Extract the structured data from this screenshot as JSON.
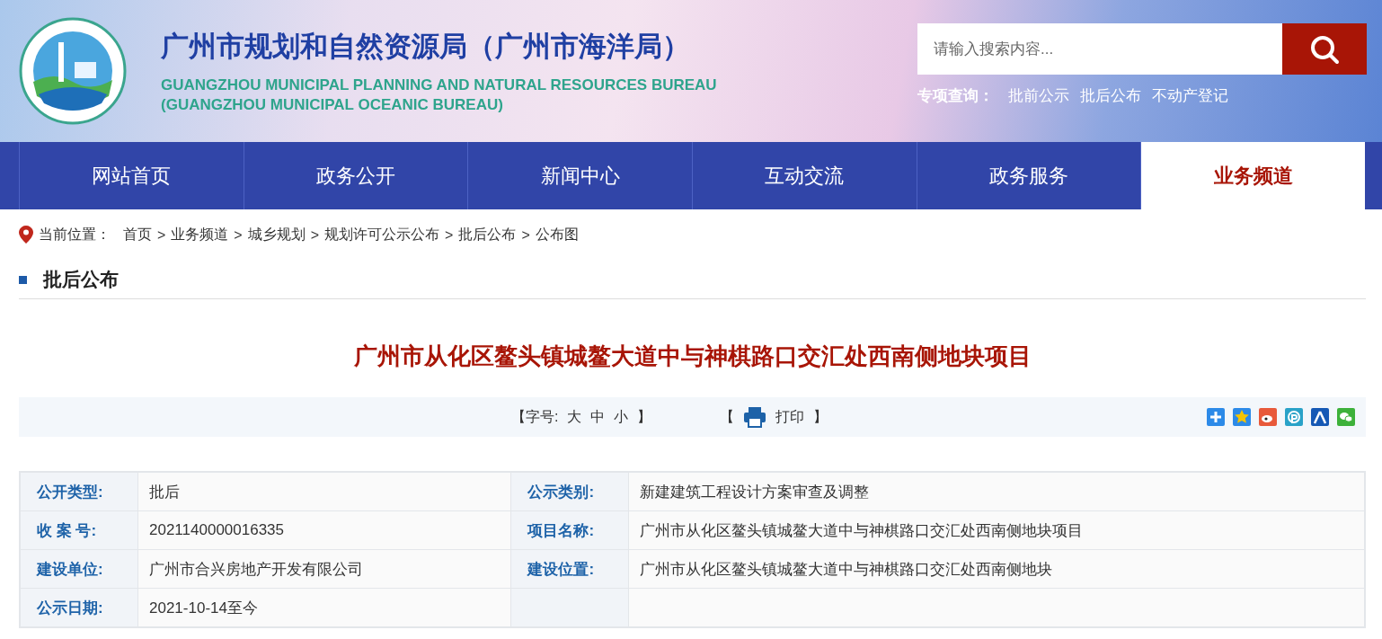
{
  "header": {
    "title": "广州市规划和自然资源局（广州市海洋局）",
    "subtitle_lines": [
      "GUANGZHOU MUNICIPAL PLANNING AND NATURAL RESOURCES BUREAU",
      "(GUANGZHOU MUNICIPAL OCEANIC BUREAU)"
    ],
    "search": {
      "placeholder": "请输入搜索内容..."
    },
    "special_query": {
      "label": "专项查询：",
      "links": [
        "批前公示",
        "批后公布",
        "不动产登记"
      ]
    }
  },
  "nav": [
    {
      "label": "网站首页",
      "selected": false
    },
    {
      "label": "政务公开",
      "selected": false
    },
    {
      "label": "新闻中心",
      "selected": false
    },
    {
      "label": "互动交流",
      "selected": false
    },
    {
      "label": "政务服务",
      "selected": false
    },
    {
      "label": "业务频道",
      "selected": true
    }
  ],
  "breadcrumb": {
    "label": "当前位置：",
    "items": [
      "首页",
      "业务频道",
      "城乡规划",
      "规划许可公示公布",
      "批后公布",
      "公布图"
    ],
    "separator": ">"
  },
  "section_title": "批后公布",
  "article_title": "广州市从化区鳌头镇城鳌大道中与神棋路口交汇处西南侧地块项目",
  "toolbar": {
    "font_open": "【字号:",
    "sizes": [
      "大",
      "中",
      "小"
    ],
    "font_close": "】",
    "print_open": "【",
    "print": "打印",
    "print_close": "】"
  },
  "table": {
    "rows": [
      [
        {
          "label": "公开类型:",
          "value": "批后"
        },
        {
          "label": "公示类别:",
          "value": "新建建筑工程设计方案审查及调整"
        }
      ],
      [
        {
          "label": "收 案 号:",
          "value": "2021140000016335"
        },
        {
          "label": "项目名称:",
          "value": "广州市从化区鳌头镇城鳌大道中与神棋路口交汇处西南侧地块项目"
        }
      ],
      [
        {
          "label": "建设单位:",
          "value": "广州市合兴房地产开发有限公司"
        },
        {
          "label": "建设位置:",
          "value": "广州市从化区鳌头镇城鳌大道中与神棋路口交汇处西南侧地块"
        }
      ],
      [
        {
          "label": "公示日期:",
          "value": "2021-10-14至今"
        }
      ]
    ]
  }
}
